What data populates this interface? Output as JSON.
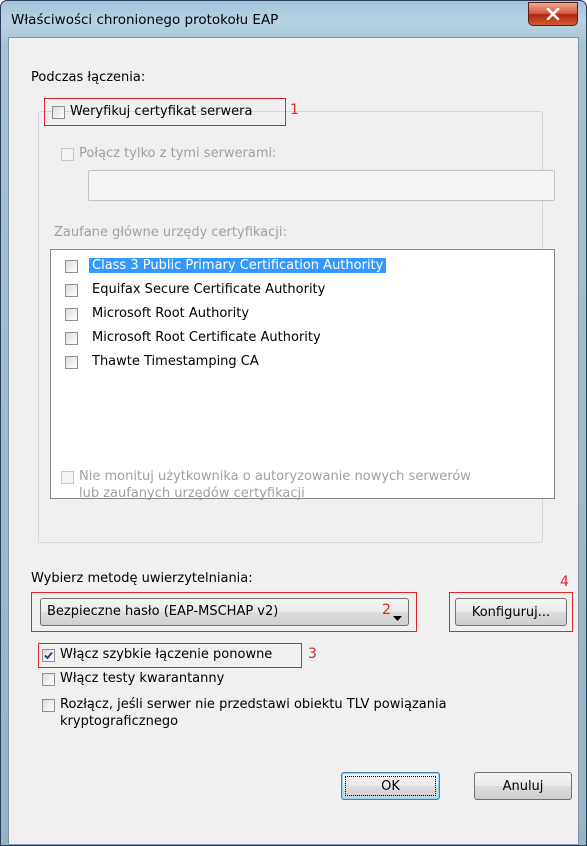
{
  "window": {
    "title": "Właściwości chronionego protokołu EAP"
  },
  "connect_section": {
    "heading": "Podczas łączenia:",
    "verify_cert": {
      "label": "Weryfikuj certyfikat serwera",
      "checked": false,
      "annotation": "1"
    },
    "connect_only": {
      "label": "Połącz tylko z tymi serwerami:",
      "checked": false,
      "disabled": true
    },
    "servers_value": "",
    "trusted_root_label": "Zaufane główne urzędy certyfikacji:",
    "trusted_roots": [
      {
        "label": "Class 3 Public Primary Certification Authority",
        "checked": false,
        "selected": true
      },
      {
        "label": "Equifax Secure Certificate Authority",
        "checked": false
      },
      {
        "label": "Microsoft Root Authority",
        "checked": false
      },
      {
        "label": "Microsoft Root Certificate Authority",
        "checked": false
      },
      {
        "label": "Thawte Timestamping CA",
        "checked": false
      }
    ],
    "no_prompt": {
      "line1": "Nie monituj użytkownika o autoryzowanie nowych serwerów",
      "line2": "lub zaufanych urzędów certyfikacji",
      "checked": false,
      "disabled": true
    }
  },
  "auth_section": {
    "heading": "Wybierz metodę uwierzytelniania:",
    "method_value": "Bezpieczne hasło (EAP-MSCHAP v2)",
    "method_annotation": "2",
    "configure_label": "Konfiguruj...",
    "configure_annotation": "4"
  },
  "options": {
    "fast_reconnect": {
      "label": "Włącz szybkie łączenie ponowne",
      "checked": true,
      "annotation": "3"
    },
    "quarantine": {
      "label": "Włącz testy kwarantanny",
      "checked": false
    },
    "disconnect": {
      "line1": "Rozłącz, jeśli serwer nie przedstawi obiektu TLV powiązania",
      "line2": "kryptograficznego",
      "checked": false
    }
  },
  "buttons": {
    "ok": "OK",
    "cancel": "Anuluj"
  },
  "colors": {
    "annotation": "#e0262a",
    "selection": "#3399ff",
    "close_button": "#c6462a"
  }
}
